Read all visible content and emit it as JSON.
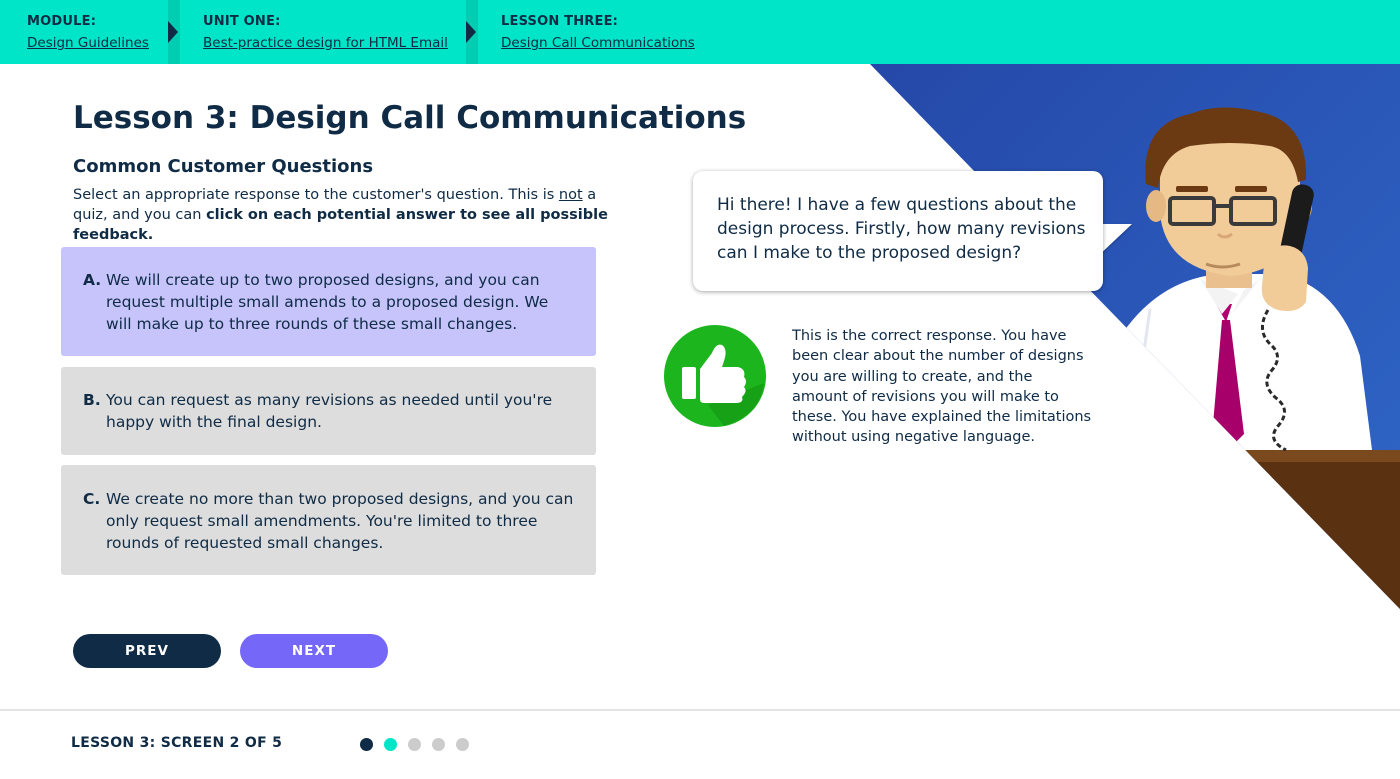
{
  "breadcrumb": {
    "module": {
      "label": "MODULE:",
      "link": "Design Guidelines"
    },
    "unit": {
      "label": "UNIT ONE:",
      "link": "Best-practice design for HTML Email"
    },
    "lesson": {
      "label": "LESSON THREE:",
      "link": "Design Call Communications"
    }
  },
  "lesson_title": "Lesson 3: Design Call Communications",
  "section_title": "Common Customer Questions",
  "instructions": {
    "part1": "Select an appropriate response to the customer's question. This is ",
    "underlined": "not",
    "part2": " a quiz, and you can ",
    "bold": "click on each potential answer to see all possible feedback."
  },
  "options": [
    {
      "letter": "A.",
      "text": "We will create up to two proposed designs, and you can request multiple small amends to a proposed design. We will make up to three rounds of these small changes.",
      "selected": true
    },
    {
      "letter": "B.",
      "text": "You can request as many revisions as needed until you're happy with the final design.",
      "selected": false
    },
    {
      "letter": "C.",
      "text": "We create no more than two proposed designs, and you can only request small amendments. You're limited to three rounds of requested small changes.",
      "selected": false
    }
  ],
  "buttons": {
    "prev": "PREV",
    "next": "NEXT"
  },
  "speech_bubble": "Hi there! I have a few questions about the design process. Firstly, how many revisions can I make to the proposed design?",
  "feedback": {
    "icon": "thumbs-up-icon",
    "text": "This is the correct response. You have been clear about the number of designs you are willing to create, and the amount of revisions you will make to these. You have explained the limitations without using negative language."
  },
  "footer": {
    "screen_label": "LESSON 3: SCREEN 2 OF 5",
    "current_screen": 2,
    "total_screens": 5
  },
  "colors": {
    "accent_teal": "#00e5c7",
    "navy": "#0f2b45",
    "selected_option": "#c6c4fb",
    "next_button": "#7567f7",
    "correct_green": "#1db51d",
    "background_blue": "#2a56b8"
  }
}
